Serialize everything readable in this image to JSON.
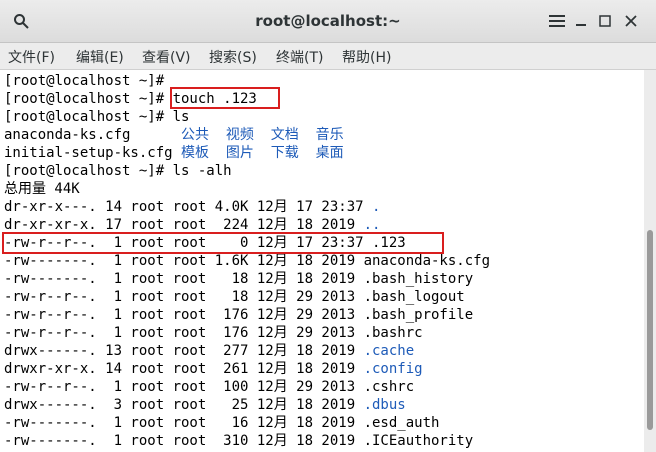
{
  "window": {
    "title": "root@localhost:~"
  },
  "titlebar": {
    "search_icon": "search-icon",
    "menu_icon": "hamburger-icon",
    "minimize": "–",
    "maximize": "▢",
    "close": "✕"
  },
  "menu": [
    "文件(F)",
    "编辑(E)",
    "查看(V)",
    "搜索(S)",
    "终端(T)",
    "帮助(H)"
  ],
  "terminal": {
    "lines": [
      "[root@localhost ~]#",
      "[root@localhost ~]# touch .123",
      "[root@localhost ~]# ls",
      "anaconda-ks.cfg      ",
      "initial-setup-ks.cfg ",
      "[root@localhost ~]# ls -alh",
      "总用量 44K",
      "dr-xr-x---. 14 root root 4.0K 12月 17 23:37 ",
      "dr-xr-xr-x. 17 root root  224 12月 18 2019 ",
      "-rw-r--r--.  1 root root    0 12月 17 23:37 .123",
      "-rw-------.  1 root root 1.6K 12月 18 2019 anaconda-ks.cfg",
      "-rw-------.  1 root root   18 12月 18 2019 .bash_history",
      "-rw-r--r--.  1 root root   18 12月 29 2013 .bash_logout",
      "-rw-r--r--.  1 root root  176 12月 29 2013 .bash_profile",
      "-rw-r--r--.  1 root root  176 12月 29 2013 .bashrc",
      "drwx------. 13 root root  277 12月 18 2019 ",
      "drwxr-xr-x. 14 root root  261 12月 18 2019 ",
      "-rw-r--r--.  1 root root  100 12月 29 2013 .cshrc",
      "drwx------.  3 root root   25 12月 18 2019 ",
      "-rw-------.  1 root root   16 12月 18 2019 .esd_auth",
      "-rw-------.  1 root root  310 12月 18 2019 .ICEauthority"
    ],
    "dirs_line3": "公共  视频  文档  音乐",
    "dirs_line4": "模板  图片  下载  桌面",
    "dot": ".",
    "dotdot": "..",
    "cache": ".cache",
    "config": ".config",
    "dbus": ".dbus"
  },
  "colors": {
    "directory": "#1e5bb8",
    "highlight_box": "#d91e1e"
  }
}
